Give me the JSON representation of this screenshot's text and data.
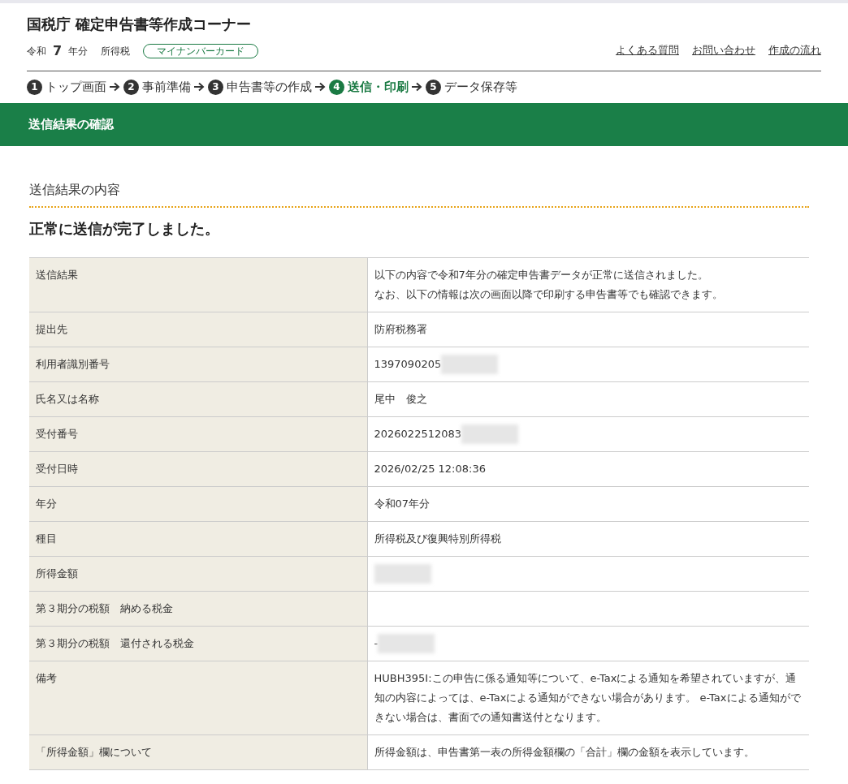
{
  "header": {
    "title": "国税庁 確定申告書等作成コーナー",
    "era": "令和",
    "year": "7",
    "year_suffix": "年分",
    "tax": "所得税",
    "badge": "マイナンバーカード",
    "links": [
      "よくある質問",
      "お問い合わせ",
      "作成の流れ"
    ]
  },
  "steps": [
    {
      "number": "1",
      "label": "トップ画面",
      "selected": false
    },
    {
      "number": "2",
      "label": "事前準備",
      "selected": false
    },
    {
      "number": "3",
      "label": "申告書等の作成",
      "selected": false
    },
    {
      "number": "4",
      "label": "送信・印刷",
      "selected": true
    },
    {
      "number": "5",
      "label": "データ保存等",
      "selected": false
    }
  ],
  "banner": "送信結果の確認",
  "section_title": "送信結果の内容",
  "message": "正常に送信が完了しました。",
  "rows": [
    {
      "label": "送信結果",
      "lines": [
        "以下の内容で令和7年分の確定申告書データが正常に送信されました。",
        "なお、以下の情報は次の画面以降で印刷する申告書等でも確認できます。"
      ],
      "redacted": false
    },
    {
      "label": "提出先",
      "value": "防府税務署",
      "redacted": false
    },
    {
      "label": "利用者識別番号",
      "value": "1397090205",
      "redacted": true
    },
    {
      "label": "氏名又は名称",
      "value": "尾中　俊之",
      "redacted": false
    },
    {
      "label": "受付番号",
      "value": "2026022512083",
      "redacted": true
    },
    {
      "label": "受付日時",
      "value": "2026/02/25 12:08:36",
      "redacted": false
    },
    {
      "label": "年分",
      "value": "令和07年分",
      "redacted": false
    },
    {
      "label": "種目",
      "value": "所得税及び復興特別所得税",
      "redacted": false
    },
    {
      "label": "所得金額",
      "redacted": true
    },
    {
      "label": "第３期分の税額　納める税金",
      "redacted": false
    },
    {
      "label": "第３期分の税額　還付される税金",
      "value": "-",
      "redacted": true
    },
    {
      "label": "備考",
      "value": "HUBH395I:この申告に係る通知等について、e-Taxによる通知を希望されていますが、通知の内容によっては、e-Taxによる通知ができない場合があります。 e-Taxによる通知ができない場合は、書面での通知書送付となります。",
      "redacted": false
    },
    {
      "label": "「所得金額」欄について",
      "value": "所得金額は、申告書第一表の所得金額欄の「合計」欄の金額を表示しています。",
      "redacted": false
    }
  ]
}
